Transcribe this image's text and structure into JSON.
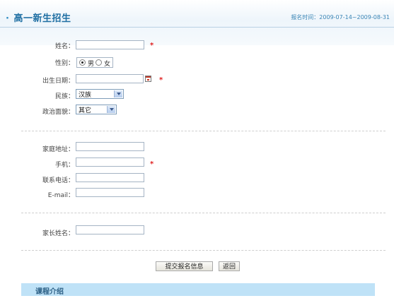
{
  "header": {
    "bullet": "·",
    "title": "高一新生招生",
    "reg_time": "报名时间：2009-07-14~2009-08-31"
  },
  "form": {
    "name_label": "姓名：",
    "gender_label": "性别：",
    "gender_male": "男",
    "gender_female": "女",
    "gender_selected": "男",
    "birth_label": "出生日期：",
    "nation_label": "民族：",
    "nation_value": "汉族",
    "politics_label": "政治面貌：",
    "politics_value": "其它",
    "address_label": "家庭地址：",
    "mobile_label": "手机：",
    "phone_label": "联系电话：",
    "email_label": "E-mail：",
    "parent_label": "家长姓名：",
    "required_mark": "*"
  },
  "buttons": {
    "submit": "提交报名信息",
    "back": "返回"
  },
  "section": {
    "course_intro": "课程介绍"
  },
  "colors": {
    "title": "#1f6fa3",
    "required": "#e02020",
    "section_bar": "#bfe2f7"
  }
}
